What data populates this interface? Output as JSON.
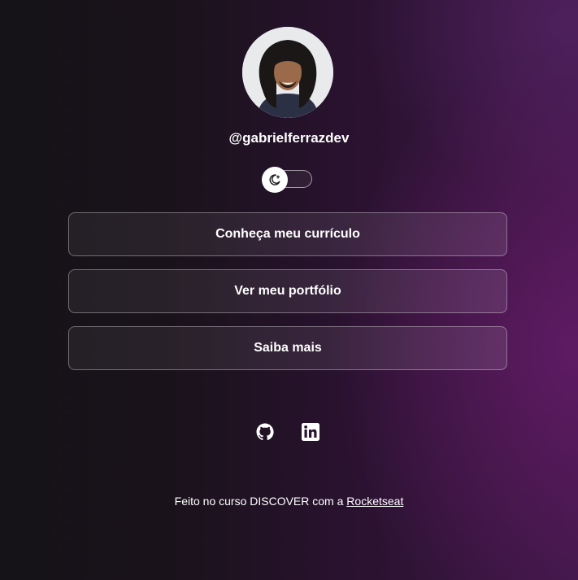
{
  "profile": {
    "username": "@gabrielferrazdev"
  },
  "theme_switch": {
    "icon": "moon-icon"
  },
  "links": [
    {
      "label": "Conheça meu currículo"
    },
    {
      "label": "Ver meu portfólio"
    },
    {
      "label": "Saiba mais"
    }
  ],
  "social": [
    {
      "icon": "github-icon"
    },
    {
      "icon": "linkedin-icon"
    }
  ],
  "footer": {
    "text": "Feito no curso DISCOVER com a ",
    "link_label": "Rocketseat"
  }
}
